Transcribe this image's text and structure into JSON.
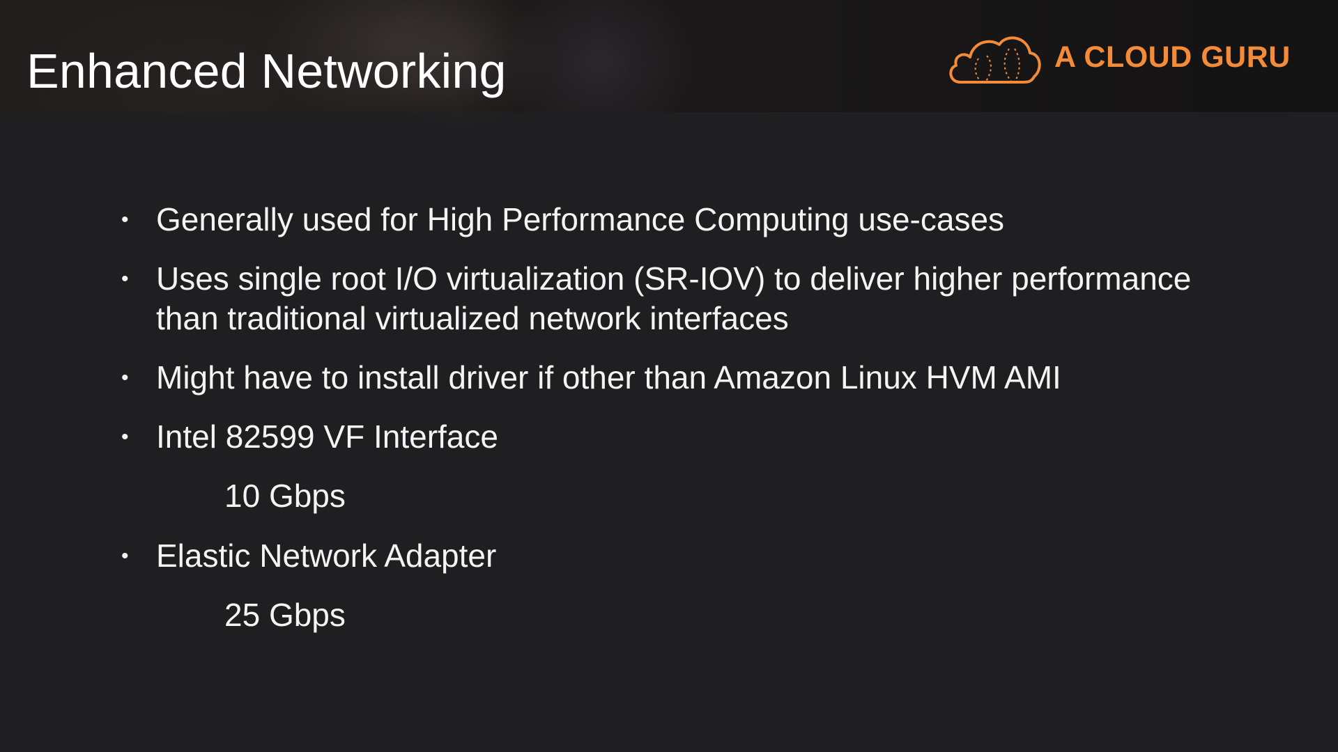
{
  "slide": {
    "title": "Enhanced Networking",
    "brand": {
      "name": "A CLOUD GURU",
      "icon": "cloud-icon",
      "color": "#f48b38"
    },
    "bullets": [
      {
        "text": "Generally used for High Performance Computing use-cases"
      },
      {
        "line1": "Uses single root I/O virtualization (SR-IOV) to deliver higher performance",
        "line2": "than traditional virtualized network interfaces"
      },
      {
        "text": "Might have to install driver if other than Amazon Linux HVM AMI"
      },
      {
        "text": "Intel 82599 VF Interface",
        "sub": "10 Gbps"
      },
      {
        "text": "Elastic Network Adapter",
        "sub": "25 Gbps"
      }
    ],
    "bullet_glyph": "•"
  }
}
